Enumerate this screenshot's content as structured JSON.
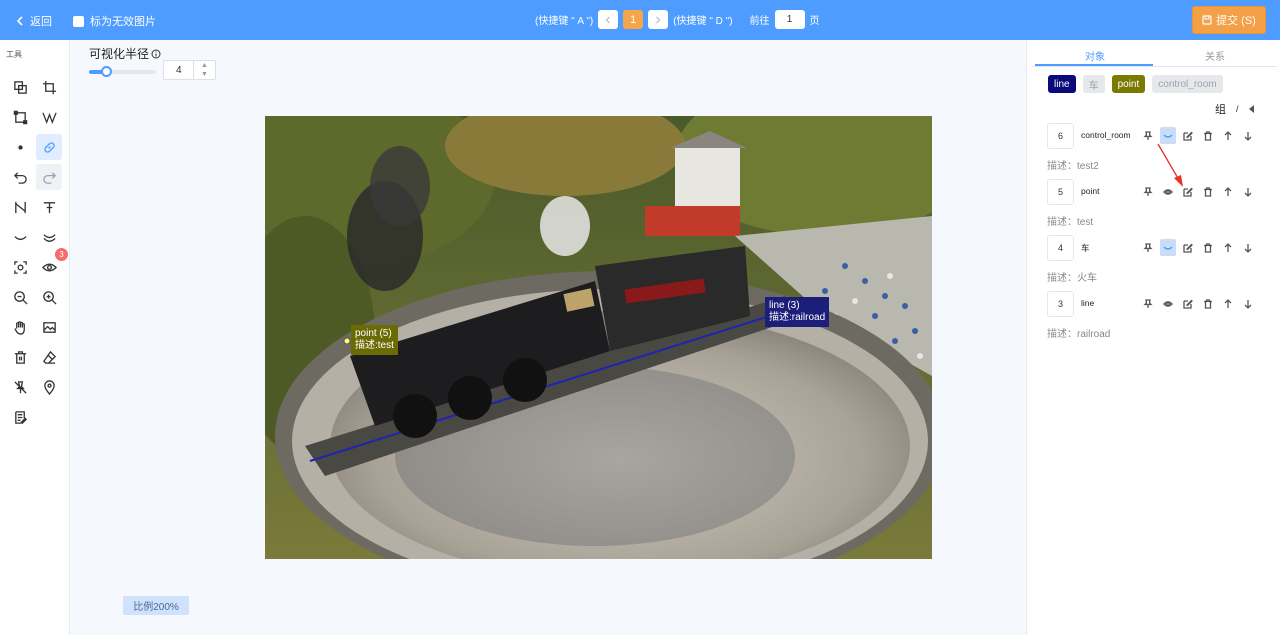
{
  "topbar": {
    "back_label": "返回",
    "invalid_label": "标为无效图片",
    "prev_hint": "(快捷键 \" A \")",
    "next_hint": "(快捷键 \" D \")",
    "current_page": "1",
    "goto_prefix": "前往",
    "goto_value": "1",
    "goto_suffix": "页",
    "submit_label": "提交 (S)"
  },
  "toolbar": {
    "title": "工具",
    "zoom_badge": "3",
    "tools": [
      "copy",
      "crop",
      "rectangle",
      "polyline",
      "point",
      "link",
      "undo",
      "redo",
      "split",
      "text-tool",
      "curve",
      "curve-multi",
      "focus",
      "eye",
      "zoom-out",
      "zoom-in",
      "pan",
      "image",
      "delete",
      "eraser",
      "pin-tool",
      "location",
      "notes"
    ]
  },
  "radius": {
    "label": "可视化半径",
    "value": "4",
    "slider_fraction": 0.25
  },
  "canvas": {
    "scale_label": "比例200%",
    "annotations": [
      {
        "title": "point (5)",
        "desc": "描述:test",
        "color": "#6b6b06"
      },
      {
        "title": "line (3)",
        "desc": "描述:railroad",
        "color": "#1c1f7a"
      }
    ]
  },
  "panel": {
    "tabs": [
      "对象",
      "关系"
    ],
    "chips": [
      {
        "label": "line",
        "bg": "#0a0a7a",
        "fg": "#ffffff"
      },
      {
        "label": "车",
        "bg": "#e6e8eb",
        "fg": "#9aa3ad"
      },
      {
        "label": "point",
        "bg": "#7a7a00",
        "fg": "#ffffff"
      },
      {
        "label": "control_room",
        "bg": "#e6e8eb",
        "fg": "#9aa3ad"
      }
    ],
    "group_label": "组",
    "group_sep": "/",
    "objects": [
      {
        "num": "6",
        "name": "control_room",
        "desc": "描述：test2"
      },
      {
        "num": "5",
        "name": "point",
        "desc": "描述：test"
      },
      {
        "num": "4",
        "name": "车",
        "desc": "描述：火车"
      },
      {
        "num": "3",
        "name": "line",
        "desc": "描述：railroad"
      }
    ]
  },
  "colors": {
    "primary": "#4e9cff",
    "submit": "#f3a047",
    "current_page": "#f5a54a"
  }
}
